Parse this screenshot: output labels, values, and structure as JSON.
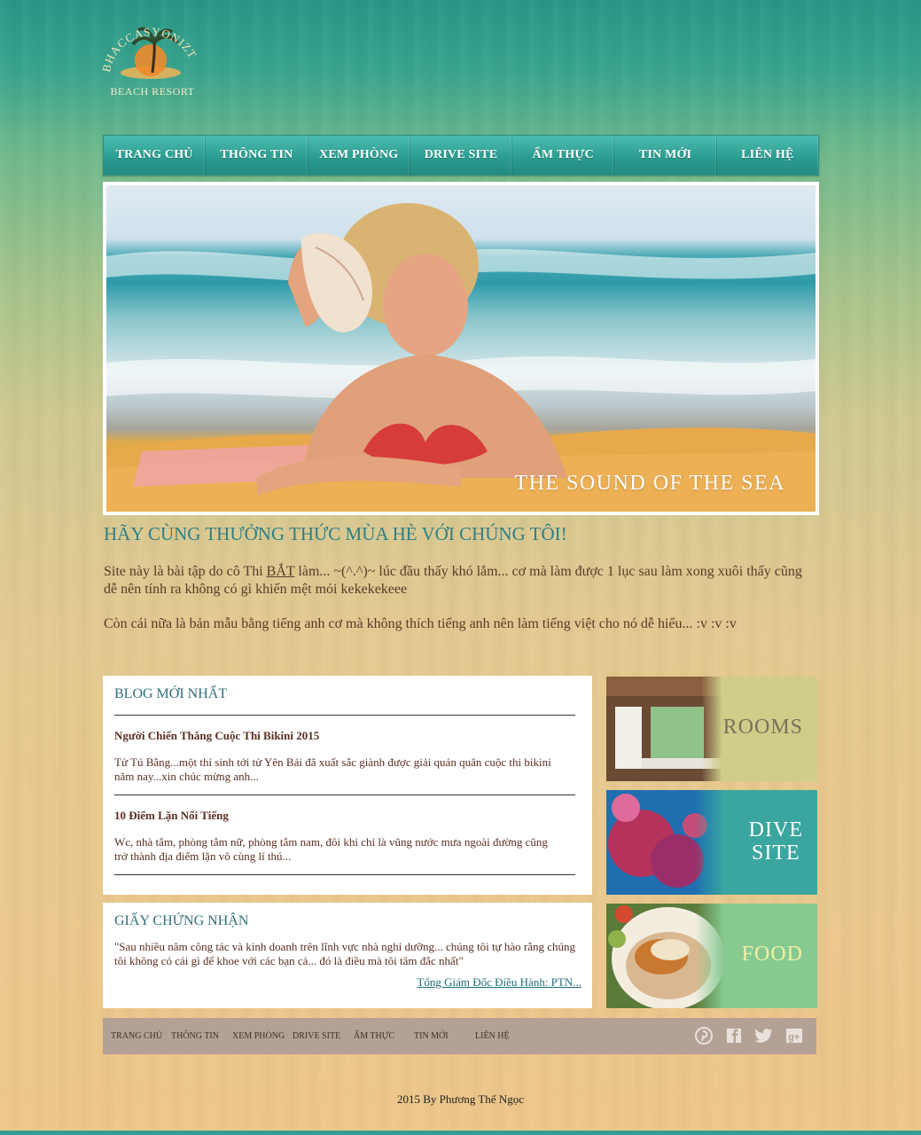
{
  "logo": {
    "arc_text": "BHACCASYONIZTAS",
    "subtitle": "BEACH RESORT"
  },
  "nav": {
    "items": [
      "TRANG CHỦ",
      "THÔNG TIN",
      "XEM PHÒNG",
      "DRIVE SITE",
      "ẨM THỰC",
      "TIN MỚI",
      "LIÊN HỆ"
    ]
  },
  "hero": {
    "caption": "THE SOUND OF THE SEA"
  },
  "intro": {
    "title": "HÃY CÙNG THƯỞNG THỨC MÙA HÈ VỚI CHÚNG TÔI!",
    "p1_before": "Site này là bài tập do cô Thi ",
    "p1_link": "BẮT",
    "p1_after": " làm... ~(^.^)~ lúc đầu thấy khó lắm... cơ mà làm được 1 lục sau làm xong xuôi thấy cũng dễ nên tính ra không có gì khiến mệt mỏi kekekekeee",
    "p2": "Còn cái nữa là bản mẫu bằng tiếng anh cơ mà không thích tiếng anh nên làm tiếng việt cho nó dễ hiểu... :v :v :v"
  },
  "blog": {
    "title": "BLOG MỚI NHẤT",
    "posts": [
      {
        "title": "Người Chiến Thắng Cuộc Thi Bikini 2015",
        "excerpt": "Tử Tú Bằng...một thí sinh tới tử Yên Bái đã xuất sắc giành được giải quán quân cuộc thi bikini năm nay...xin chúc mừng anh..."
      },
      {
        "title": "10 Điểm Lặn Nổi Tiếng",
        "excerpt": "Wc, nhà tắm, phòng tắm nữ, phòng tắm nam, đôi khi chỉ là vũng nước mưa ngoài đường cũng trở thành địa điểm lặn vô cùng lí thú..."
      }
    ]
  },
  "certificate": {
    "title": "GIẤY CHỨNG NHẬN",
    "quote": "\"Sau nhiều năm công tác và kinh doanh trên lĩnh vực nhà nghỉ dưỡng... chúng tôi tự hào rằng chúng tôi không có cái gì để khoe với các bạn cả... đó là điều mà tôi tâm đắc nhất\"",
    "signature": "Tổng Giám Đốc Điều Hành: PTN..."
  },
  "tiles": [
    {
      "label": "ROOMS",
      "color": "#cfcd8a",
      "text_color": "#7c6f5a"
    },
    {
      "label": "DIVE\nSITE",
      "color": "#3aa69f",
      "text_color": "#ffffff"
    },
    {
      "label": "FOOD",
      "color": "#86c991",
      "text_color": "#f2f0a3"
    }
  ],
  "footer": {
    "links": [
      "TRANG CHỦ",
      "THÔNG TIN",
      "XEM PHÒNG",
      "DRIVE SITE",
      "ẨM THỰC",
      "TIN MỚI",
      "LIÊN HỆ"
    ],
    "social_icons": [
      "pinterest-icon",
      "facebook-icon",
      "twitter-icon",
      "google-plus-icon"
    ],
    "copyright": "2015 By Phương Thế Ngọc"
  },
  "colors": {
    "nav": "#2d9d91",
    "heading": "#2d7f87",
    "body_text": "#5a3a2a",
    "footer_bar": "#b3a196"
  }
}
